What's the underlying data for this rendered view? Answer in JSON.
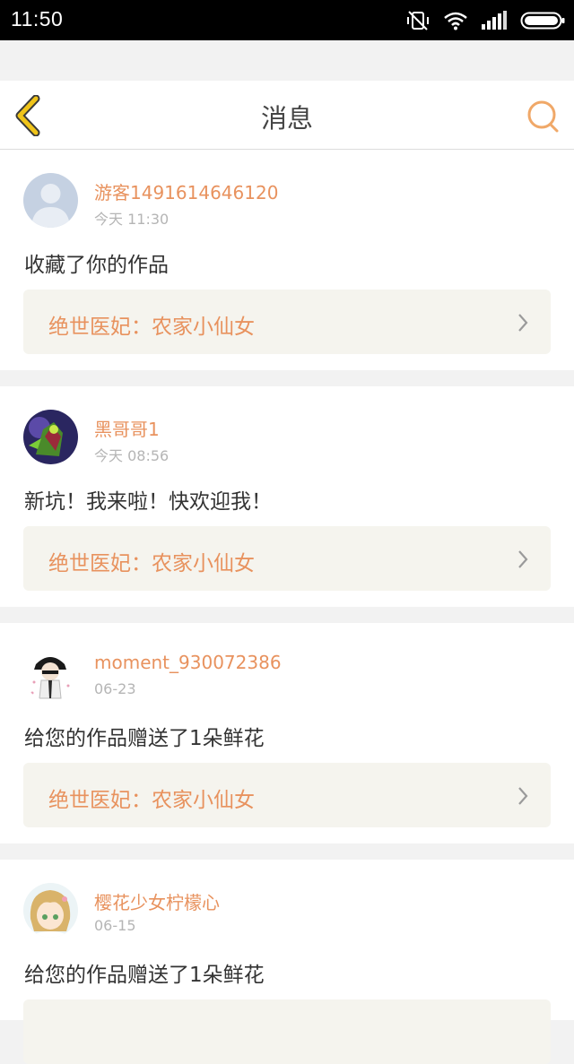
{
  "status_bar": {
    "time": "11:50"
  },
  "header": {
    "title": "消息"
  },
  "messages": [
    {
      "username": "游客1491614646120",
      "time": "今天 11:30",
      "text": "收藏了你的作品",
      "work_title": "绝世医妃：农家小仙女"
    },
    {
      "username": "黑哥哥1",
      "time": "今天 08:56",
      "text": "新坑！我来啦！快欢迎我！",
      "work_title": "绝世医妃：农家小仙女"
    },
    {
      "username": "moment_930072386",
      "time": "06-23",
      "text": "给您的作品赠送了1朵鲜花",
      "work_title": "绝世医妃：农家小仙女"
    },
    {
      "username": "樱花少女柠檬心",
      "time": "06-15",
      "text": "给您的作品赠送了1朵鲜花",
      "work_title": ""
    }
  ],
  "colors": {
    "accent": "#e8925e",
    "back_icon": "#f0c419",
    "search_icon": "#f0a868",
    "card_link_bg": "#f5f4ee"
  }
}
